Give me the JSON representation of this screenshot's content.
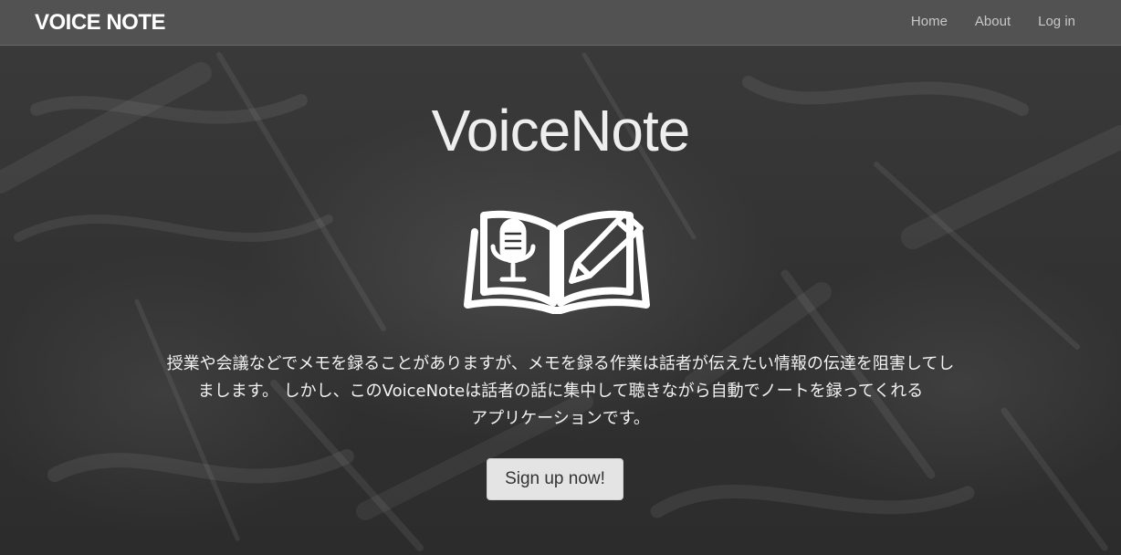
{
  "navbar": {
    "brand": "VOICE NOTE",
    "links": [
      {
        "label": "Home"
      },
      {
        "label": "About"
      },
      {
        "label": "Log in"
      }
    ]
  },
  "hero": {
    "title": "VoiceNote",
    "logo_icon": "book-microphone-pencil-icon",
    "description_lines": [
      "授業や会議などでメモを録ることがありますが、メモを録る作業は話者が伝えたい情報の伝達を阻害してし",
      "まします。 しかし、このVoiceNoteは話者の話に集中して聴きながら自動でノートを録ってくれる",
      "アプリケーションです。"
    ],
    "cta_label": "Sign up now!"
  },
  "colors": {
    "background": "#333333",
    "navbar": "#5c5c5c",
    "text": "#eeeeee",
    "button": "#e4e4e4"
  }
}
